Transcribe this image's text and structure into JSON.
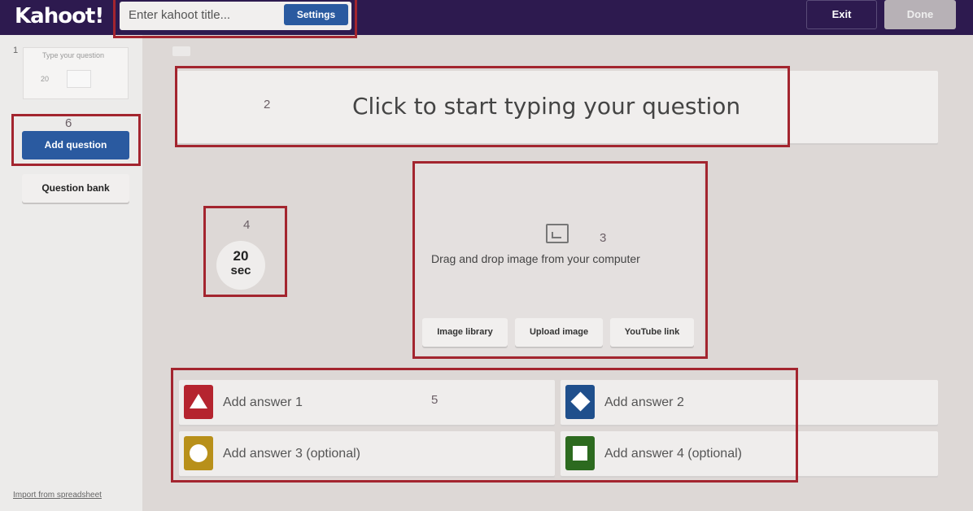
{
  "app": {
    "logo": "Kahoot!"
  },
  "header": {
    "title_placeholder": "Enter kahoot title...",
    "settings_label": "Settings",
    "exit_label": "Exit",
    "done_label": "Done"
  },
  "sidebar": {
    "slide_number": "1",
    "thumbnail_text": "Type your question",
    "thumbnail_time": "20",
    "add_question_label": "Add question",
    "question_bank_label": "Question bank",
    "import_link": "Import from spreadsheet"
  },
  "question": {
    "placeholder": "Click to start typing your question"
  },
  "timer": {
    "value": "20",
    "unit": "sec"
  },
  "media": {
    "drag_text": "Drag and drop image from your computer",
    "buttons": [
      "Image library",
      "Upload image",
      "YouTube link"
    ]
  },
  "answers": [
    {
      "label": "Add answer 1",
      "color": "#b5242f",
      "shape": "triangle"
    },
    {
      "label": "Add answer 2",
      "color": "#1f4f8c",
      "shape": "diamond"
    },
    {
      "label": "Add answer 3 (optional)",
      "color": "#b8901a",
      "shape": "circle"
    },
    {
      "label": "Add answer 4 (optional)",
      "color": "#2c6a1f",
      "shape": "square"
    }
  ],
  "annotations": [
    "1",
    "2",
    "3",
    "4",
    "5",
    "6"
  ],
  "colors": {
    "topbar": "#2d1a4f",
    "primary_button": "#2a5aa0",
    "highlight_box": "#a3252f"
  }
}
